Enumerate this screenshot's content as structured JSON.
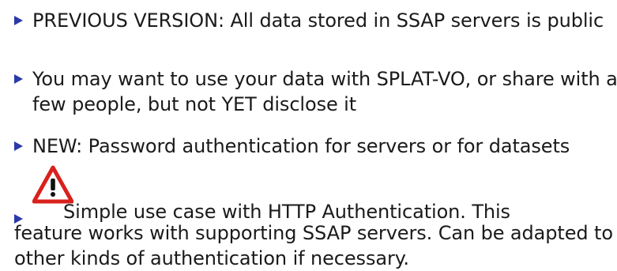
{
  "bullets": [
    "PREVIOUS VERSION: All data stored in SSAP servers is public",
    "You may want to use your data with SPLAT-VO, or share with a few people, but not YET disclose it",
    "NEW: Password authentication for servers or for datasets"
  ],
  "warning_item": {
    "icon": "warning-triangle-icon",
    "first_line": "Simple use case with HTTP Authentication. This",
    "rest": "feature works with supporting SSAP servers. Can be adapted to other kinds of authentication if necessary."
  },
  "colors": {
    "bullet_marker": "#2b3aa8",
    "warning_red": "#d9211c",
    "text": "#1a1a1a"
  }
}
